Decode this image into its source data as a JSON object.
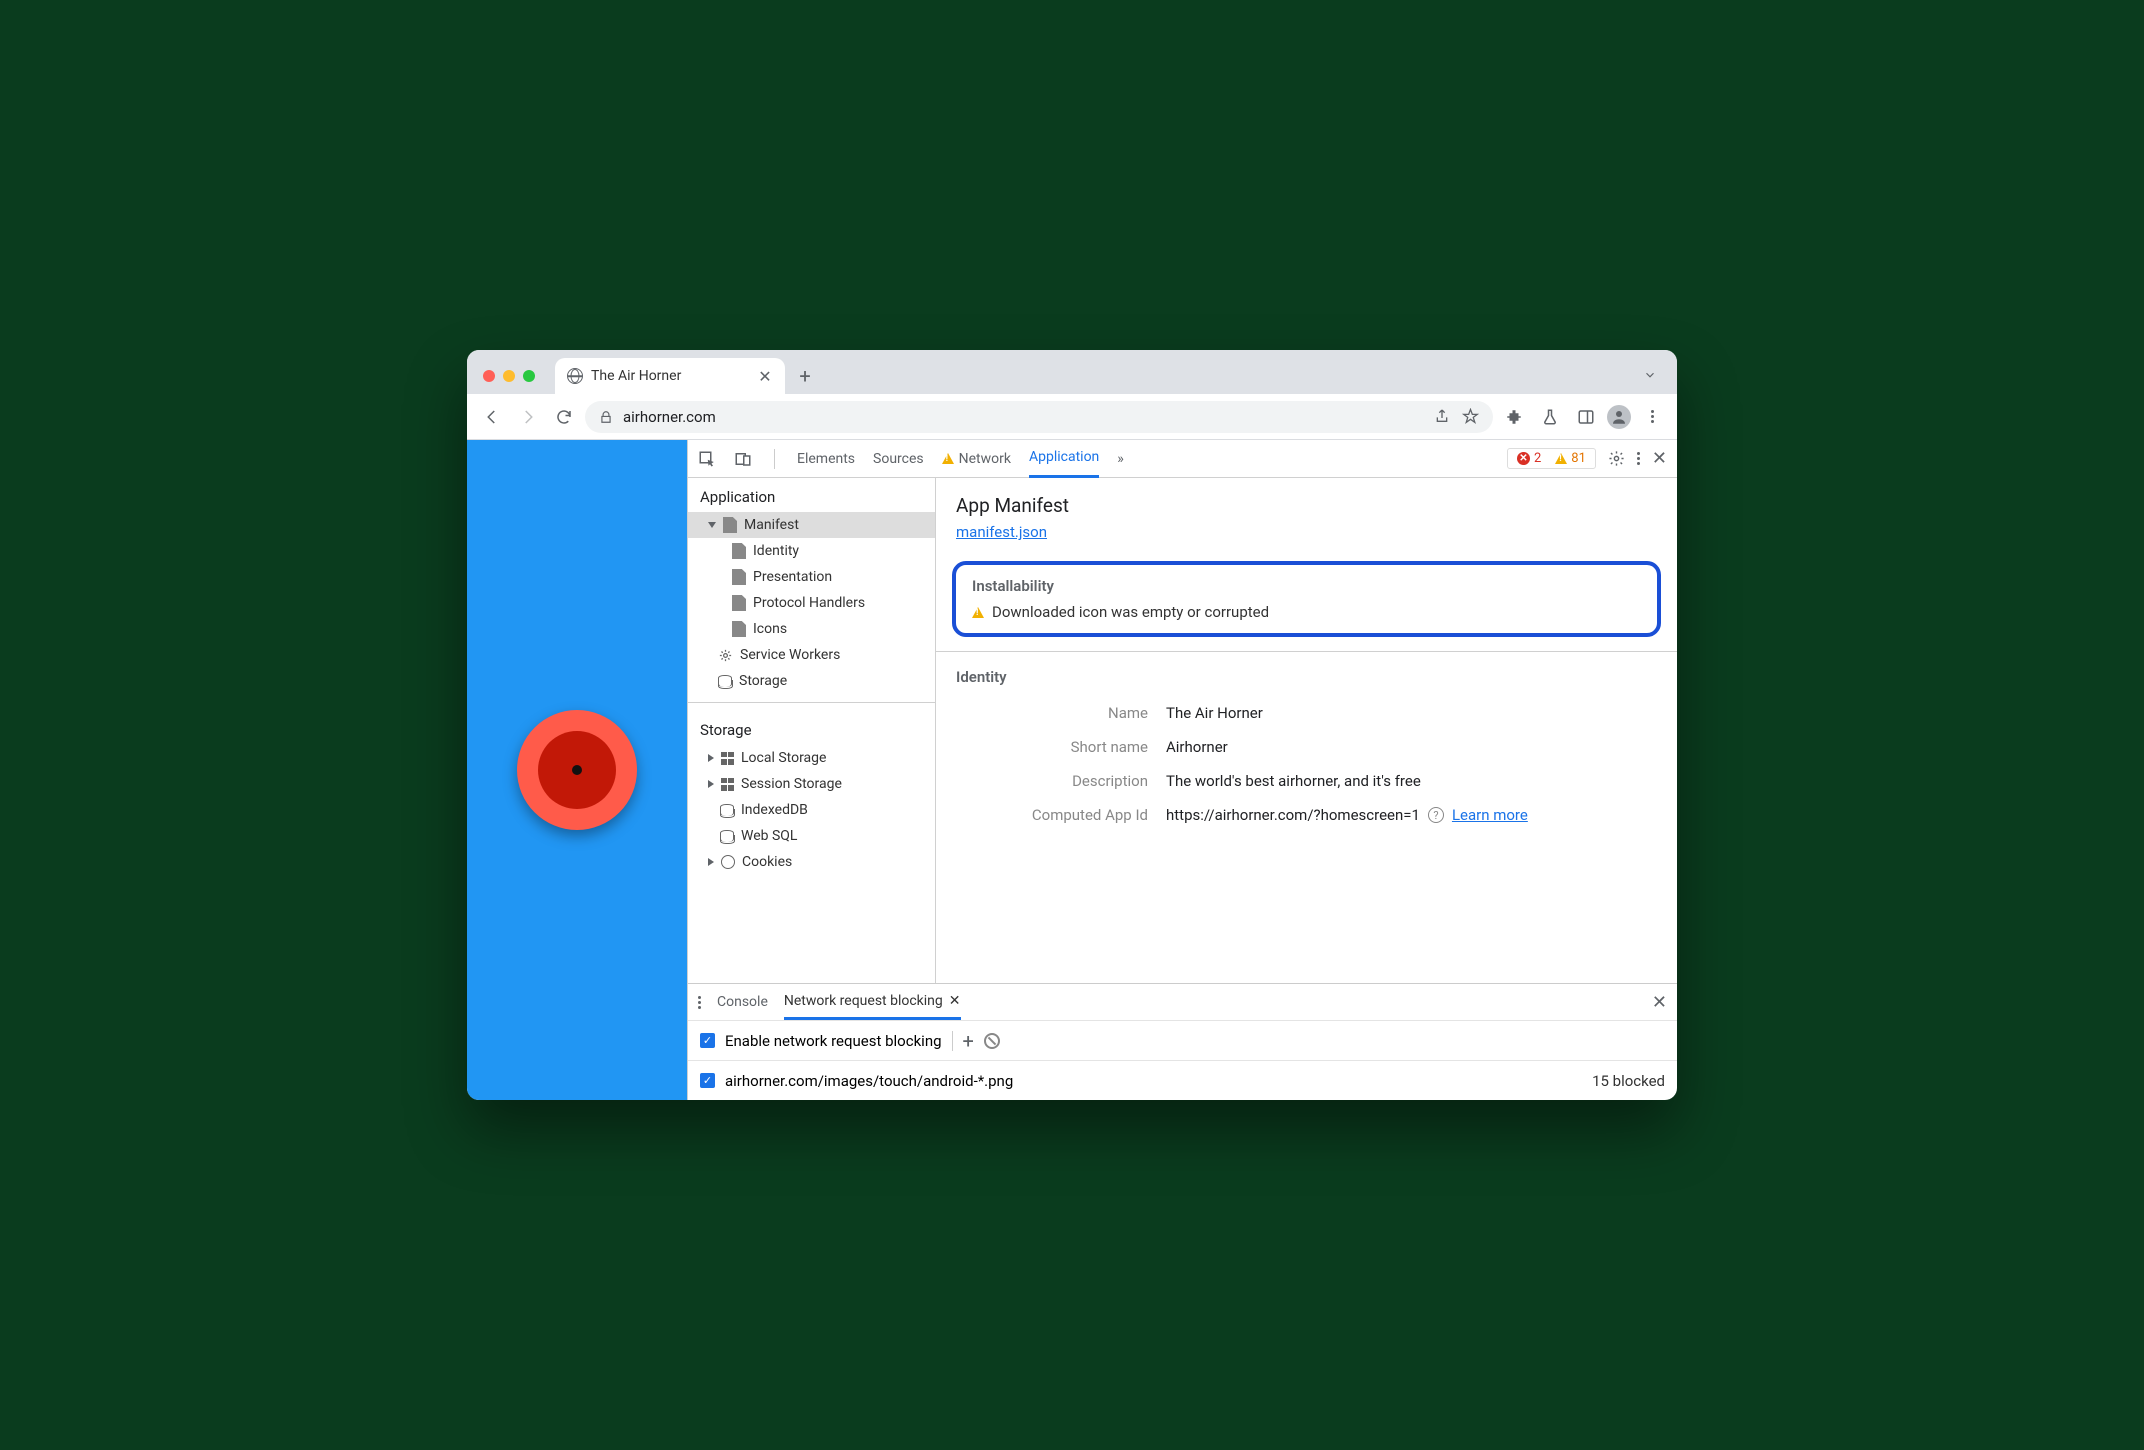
{
  "browser": {
    "tab_title": "The Air Horner",
    "url": "airhorner.com"
  },
  "devtools": {
    "tabs": {
      "elements": "Elements",
      "sources": "Sources",
      "network": "Network",
      "application": "Application"
    },
    "errors_count": "2",
    "warnings_count": "81",
    "sidebar": {
      "application_header": "Application",
      "manifest": "Manifest",
      "identity": "Identity",
      "presentation": "Presentation",
      "protocol_handlers": "Protocol Handlers",
      "icons": "Icons",
      "service_workers": "Service Workers",
      "storage": "Storage",
      "storage_header": "Storage",
      "local_storage": "Local Storage",
      "session_storage": "Session Storage",
      "indexeddb": "IndexedDB",
      "web_sql": "Web SQL",
      "cookies": "Cookies"
    },
    "manifest_panel": {
      "title": "App Manifest",
      "link": "manifest.json",
      "installability_title": "Installability",
      "installability_msg": "Downloaded icon was empty or corrupted",
      "identity_title": "Identity",
      "name_label": "Name",
      "name_value": "The Air Horner",
      "short_name_label": "Short name",
      "short_name_value": "Airhorner",
      "description_label": "Description",
      "description_value": "The world's best airhorner, and it's free",
      "app_id_label": "Computed App Id",
      "app_id_value": "https://airhorner.com/?homescreen=1",
      "learn_more": "Learn more"
    },
    "drawer": {
      "console": "Console",
      "nrb": "Network request blocking",
      "enable_label": "Enable network request blocking",
      "pattern": "airhorner.com/images/touch/android-*.png",
      "blocked": "15 blocked"
    }
  }
}
